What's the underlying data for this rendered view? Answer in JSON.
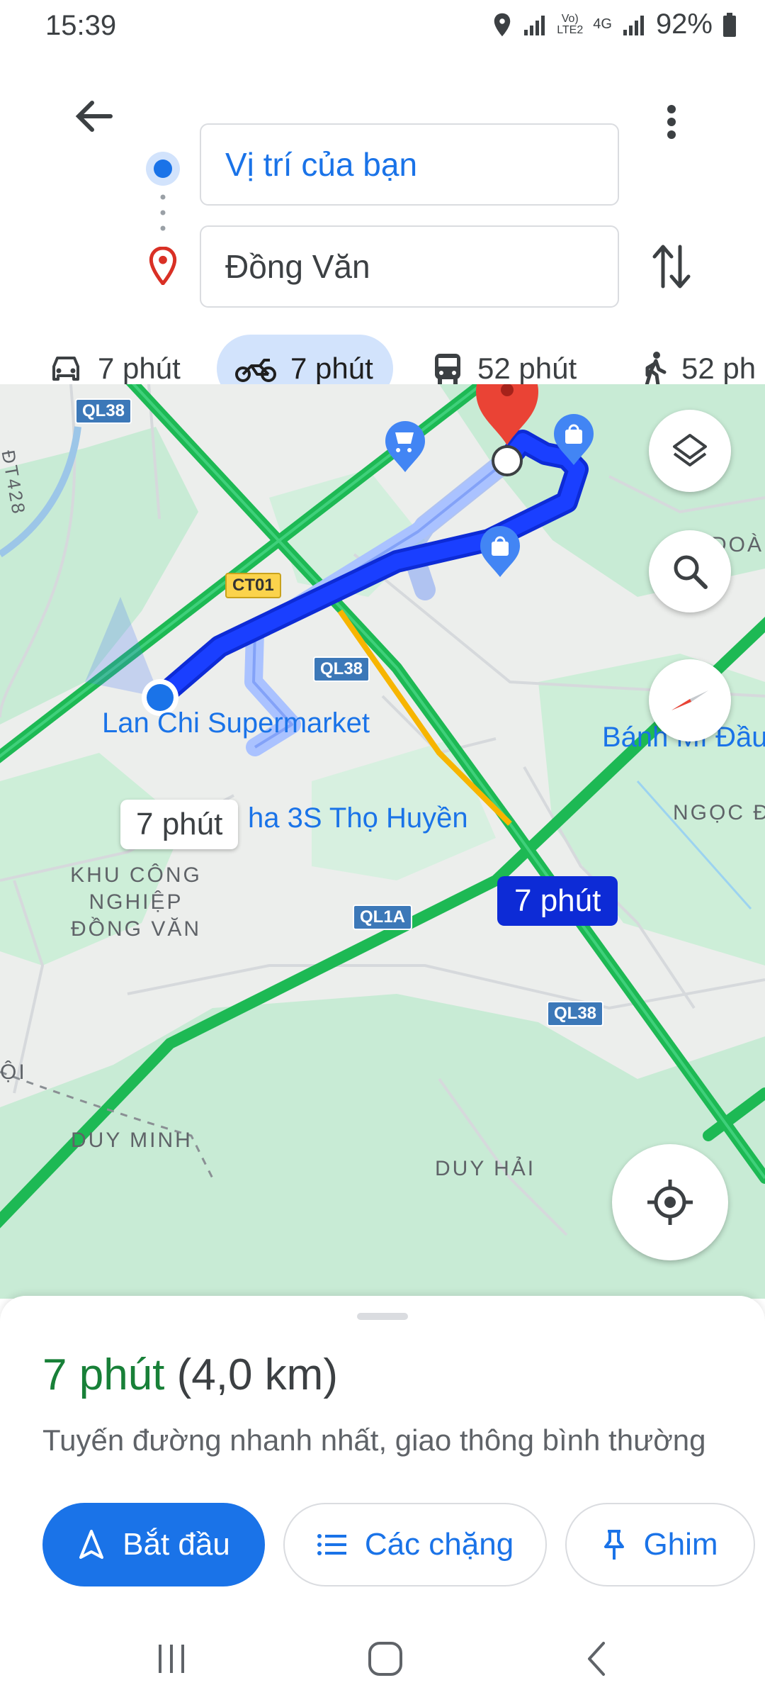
{
  "status_bar": {
    "time": "15:39",
    "network": "4G",
    "battery": "92%"
  },
  "directions": {
    "origin": "Vị trí của bạn",
    "destination": "Đồng Văn"
  },
  "travel_modes": [
    {
      "mode": "car",
      "icon": "car-icon",
      "label": "7 phút",
      "selected": false
    },
    {
      "mode": "motorbike",
      "icon": "motorbike-icon",
      "label": "7 phút",
      "selected": true
    },
    {
      "mode": "transit",
      "icon": "bus-icon",
      "label": "52 phút",
      "selected": false
    },
    {
      "mode": "walk",
      "icon": "walk-icon",
      "label": "52 ph",
      "selected": false
    }
  ],
  "map": {
    "places": {
      "supermarket": "Lan Chi Supermarket",
      "shop": "ha 3S Thọ Huyền",
      "bakery": "Bánh Mì Đầu",
      "industrial_zone": "KHU CÔNG NGHIỆP ĐỒNG VĂN",
      "duy_minh": "DUY MINH",
      "duy_hai": "DUY HẢI",
      "ngoc": "NGỌC Đ",
      "doan": "ĐOÀN",
      "edge_left": "ỘI",
      "dt428": "ĐT428"
    },
    "roads": {
      "ql38_a": "QL38",
      "ql38_b": "QL38",
      "ql38_c": "QL38",
      "ct01": "CT01",
      "ql1a": "QL1A"
    },
    "route_labels": {
      "primary": "7 phút",
      "alternate": "7 phút"
    },
    "colors": {
      "route": "#1a3fff",
      "alt_route": "#a8c0ff",
      "highway": "#1db954",
      "destination_pin": "#ea4335"
    }
  },
  "summary": {
    "time": "7 phút",
    "distance": "(4,0 km)",
    "description": "Tuyến đường nhanh nhất, giao thông bình thường"
  },
  "actions": {
    "start": "Bắt đầu",
    "steps": "Các chặng",
    "pin": "Ghim"
  }
}
